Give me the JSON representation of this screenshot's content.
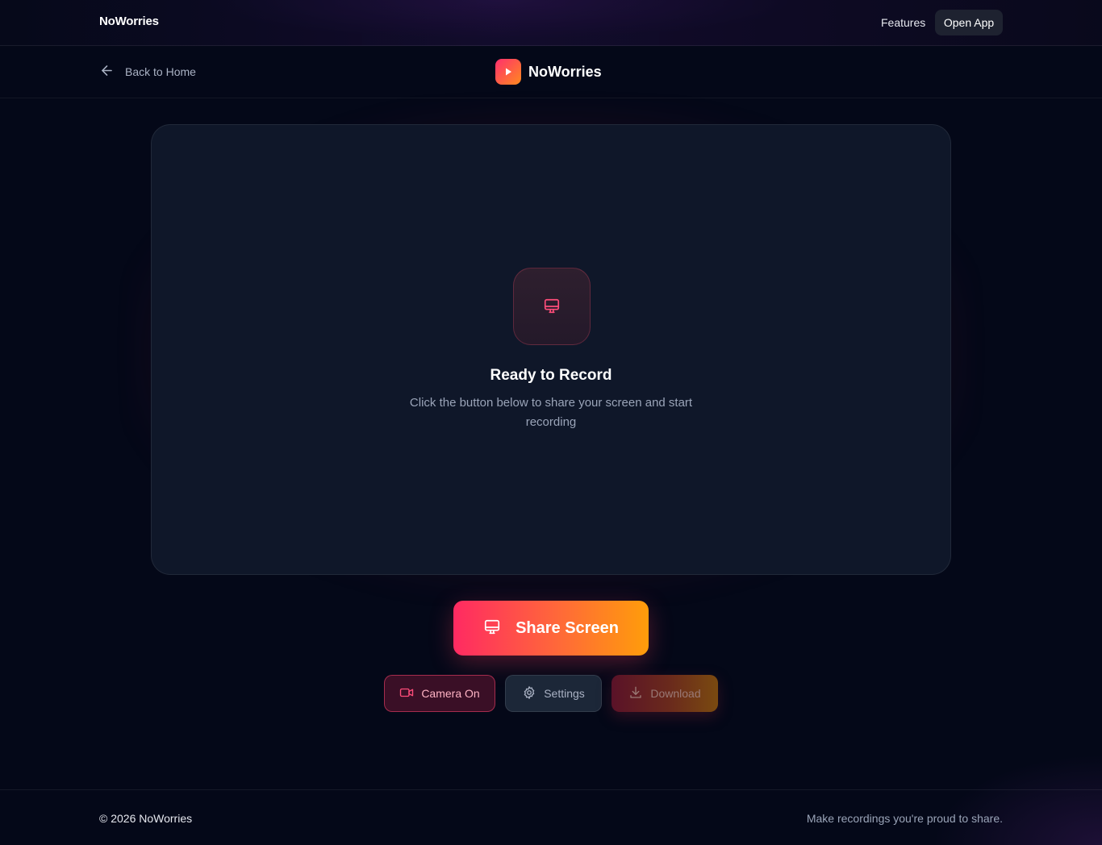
{
  "topnav": {
    "brand": "NoWorries",
    "features_label": "Features",
    "open_app_label": "Open App"
  },
  "subheader": {
    "back_label": "Back to Home",
    "brand": "NoWorries"
  },
  "stage": {
    "title": "Ready to Record",
    "subtitle": "Click the button below to share your screen and start recording",
    "icon": "monitor-icon"
  },
  "actions": {
    "share_label": "Share Screen",
    "camera_label": "Camera On",
    "settings_label": "Settings",
    "download_label": "Download",
    "download_disabled": true
  },
  "footer": {
    "copyright": "© 2026 NoWorries",
    "tagline": "Make recordings you're proud to share."
  },
  "colors": {
    "background": "#040818",
    "stage": "#0f1729",
    "accent_start": "#ff2a62",
    "accent_end": "#ff9d0a"
  }
}
